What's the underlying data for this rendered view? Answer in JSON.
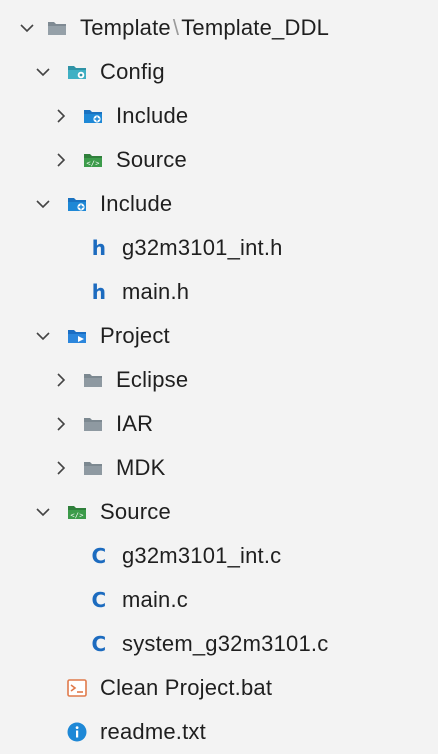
{
  "tree": {
    "root": {
      "label_a": "Template",
      "sep": "\\",
      "label_b": "Template_DDL"
    },
    "config": {
      "label": "Config"
    },
    "config_include": {
      "label": "Include"
    },
    "config_source": {
      "label": "Source"
    },
    "include": {
      "label": "Include"
    },
    "include_int_h": {
      "label": "g32m3101_int.h"
    },
    "include_main_h": {
      "label": "main.h"
    },
    "project": {
      "label": "Project"
    },
    "project_eclipse": {
      "label": "Eclipse"
    },
    "project_iar": {
      "label": "IAR"
    },
    "project_mdk": {
      "label": "MDK"
    },
    "source": {
      "label": "Source"
    },
    "source_int_c": {
      "label": "g32m3101_int.c"
    },
    "source_main_c": {
      "label": "main.c"
    },
    "source_system_c": {
      "label": "system_g32m3101.c"
    },
    "clean_bat": {
      "label": "Clean Project.bat"
    },
    "readme": {
      "label": "readme.txt"
    }
  },
  "glyphs": {
    "header": "h",
    "c_source": "C"
  },
  "colors": {
    "accent_blue": "#1c6bbf",
    "folder_grey": "#8a949c",
    "folder_green": "#3c9b4a",
    "folder_blue": "#1e88d6",
    "bat_orange": "#e07a4b"
  }
}
